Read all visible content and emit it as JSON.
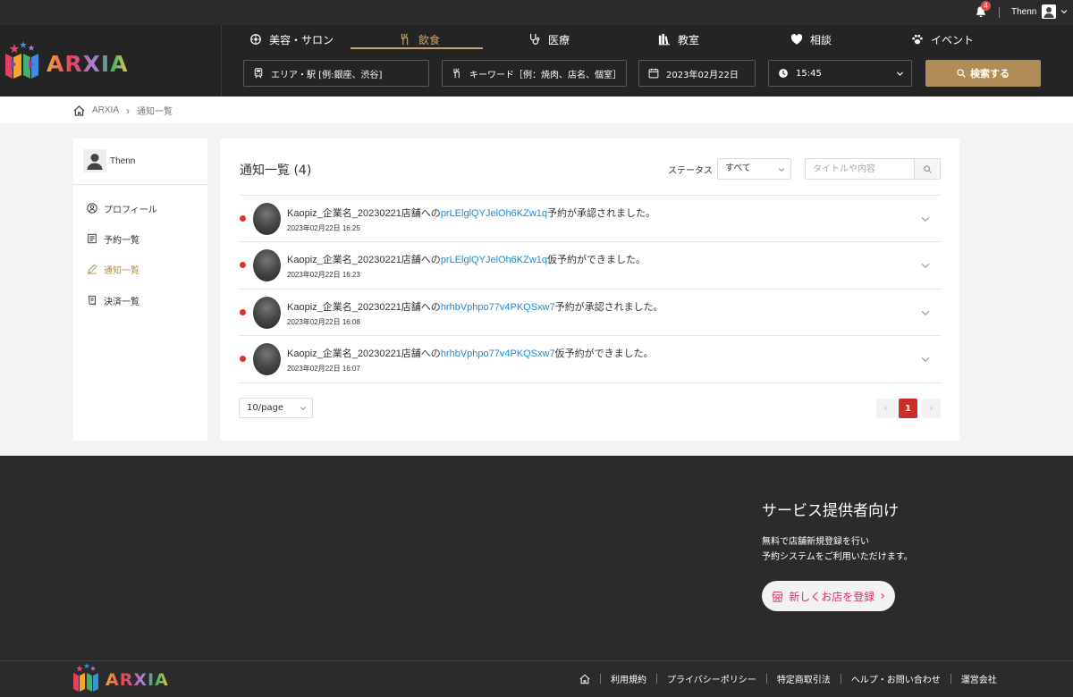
{
  "topbar": {
    "notification_count": "4",
    "user_name": "Thenn"
  },
  "brand": {
    "name": "ARXIA"
  },
  "categories": [
    {
      "label": "美容・サロン",
      "icon": "salon-icon",
      "active": false
    },
    {
      "label": "飲食",
      "icon": "fork-knife-icon",
      "active": true
    },
    {
      "label": "医療",
      "icon": "stethoscope-icon",
      "active": false
    },
    {
      "label": "教室",
      "icon": "books-icon",
      "active": false
    },
    {
      "label": "相談",
      "icon": "heart-icon",
      "active": false
    },
    {
      "label": "イベント",
      "icon": "paw-icon",
      "active": false
    }
  ],
  "search": {
    "area_placeholder": "エリア・駅 [例:銀座、渋谷]",
    "keyword_placeholder": "キーワード［例：焼肉、店名、個室］",
    "date": "2023年02月22日",
    "time": "15:45",
    "button": "検索する"
  },
  "breadcrumb": {
    "home": "ARXIA",
    "current": "通知一覧"
  },
  "sidebar": {
    "user_name": "Thenn",
    "items": [
      {
        "label": "プロフィール",
        "icon": "user-circle-icon"
      },
      {
        "label": "予約一覧",
        "icon": "document-icon"
      },
      {
        "label": "通知一覧",
        "icon": "pencil-icon",
        "active": true
      },
      {
        "label": "決済一覧",
        "icon": "receipt-icon"
      }
    ]
  },
  "main": {
    "title": "通知一覧 (4)",
    "status_label": "ステータス",
    "status_value": "すべて",
    "filter_placeholder": "タイトルや内容",
    "notifications": [
      {
        "prefix": "Kaopiz_企業名_20230221店舗への",
        "link": "prLElglQYJelOh6KZw1q",
        "suffix": "予約が承認されました。",
        "date": "2023年02月22日 16:25"
      },
      {
        "prefix": "Kaopiz_企業名_20230221店舗への",
        "link": "prLElglQYJelOh6KZw1q",
        "suffix": "仮予約ができました。",
        "date": "2023年02月22日 16:23"
      },
      {
        "prefix": "Kaopiz_企業名_20230221店舗への",
        "link": "hrhbVphpo77v4PKQSxw7",
        "suffix": "予約が承認されました。",
        "date": "2023年02月22日 16:08"
      },
      {
        "prefix": "Kaopiz_企業名_20230221店舗への",
        "link": "hrhbVphpo77v4PKQSxw7",
        "suffix": "仮予約ができました。",
        "date": "2023年02月22日 16:07"
      }
    ],
    "page_size": "10/page",
    "pagination": {
      "prev": "‹",
      "current": "1",
      "next": "›"
    }
  },
  "footer": {
    "title": "サービス提供者向け",
    "desc_line1": "無料で店舗新規登録を行い",
    "desc_line2": "予約システムをご利用いただけます。",
    "register_button": "新しくお店を登録",
    "register_arrow": "›",
    "links": [
      "利用規約",
      "プライバシーポリシー",
      "特定商取引法",
      "ヘルプ・お問い合わせ",
      "運営会社"
    ]
  },
  "colors": {
    "accent_gold": "#b08d57",
    "active_gold": "#c9a46a",
    "link_blue": "#1a8cd8",
    "unread_red": "#d33a2c",
    "page_red": "#c9302c",
    "register_pink": "#d6336c"
  }
}
